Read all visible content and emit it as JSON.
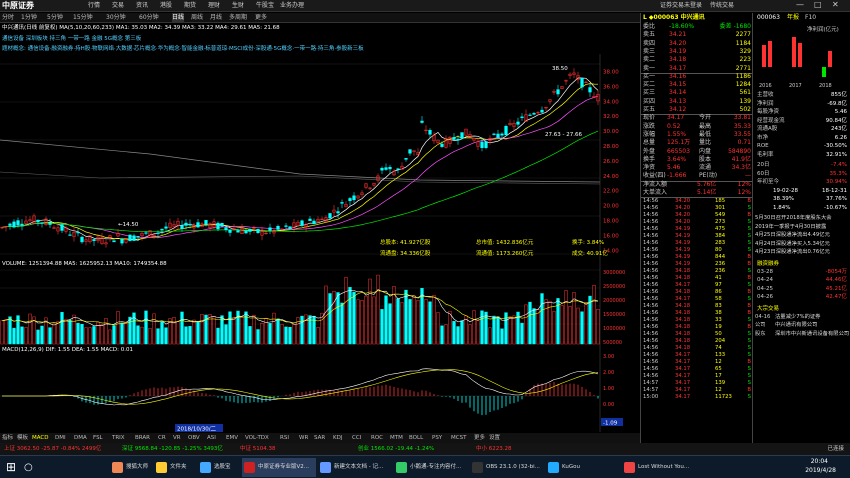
{
  "app": {
    "logo": "中原证券",
    "menu": [
      "系统",
      "功能",
      "报价",
      "分析",
      "资讯",
      "港股",
      "期权",
      "融资",
      "智能",
      "帮助"
    ],
    "menu2": [
      "行情",
      "交易",
      "资讯",
      "港股",
      "期货",
      "理财",
      "生财",
      "牛股宝",
      "业务办理"
    ],
    "title_right": "证券交易未登录",
    "title_right2": "传统交易"
  },
  "periods": [
    "分时",
    "1分钟",
    "5分钟",
    "15分钟",
    "30分钟",
    "60分钟",
    "日线",
    "周线",
    "月线",
    "多周期",
    "更多"
  ],
  "info_line": "中兴通讯(日线 前复权)  MA(5,10,20,60,233) MA1: 35.03  MA2: 34.39  MA3: 33.22  MA4: 29.61  MA5: 21.68",
  "tags_line": "通信设备   深圳板块   持三角 一带一路   金融 5G概念   第三板",
  "tags_line2": "题材概念:  通信设备·融资融券·持H股·物联网络·大数据·芯片概念·华为概念·智能金融·标普道琼·MSCI成份·深股通·5G概念·一带一路·持三角·参股新三板",
  "chart": {
    "high_label": "38.50",
    "low_label": "14.50",
    "range_label": "27.63 - 27.66",
    "annotations": {
      "a1": "总股本: 41.927亿股",
      "a2": "流通盘: 34.336亿股",
      "a3": "总市值: 1432.836亿元",
      "a4": "流通值: 1173.260亿元",
      "a5": "换手: 3.84%",
      "a6": "成交: 40.91亿"
    },
    "price_axis": [
      "38.00",
      "36.00",
      "34.00",
      "32.00",
      "30.00",
      "28.00",
      "26.00",
      "24.00",
      "22.00",
      "20.00",
      "18.00",
      "16.00",
      "14.00"
    ],
    "vol_label": "VOLUME: 1251394.88  MA5: 1625952.13  MA10: 1749354.88",
    "vol_axis": [
      "3000000",
      "2500000",
      "2000000",
      "1500000",
      "1000000",
      "500000"
    ],
    "macd_label": "MACD(12,26,9)  DIF: 1.55  DEA: 1.55  MACD: 0.01",
    "macd_axis": [
      "3.00",
      "2.00",
      "1.00",
      "0.00",
      "-1.00"
    ],
    "date_marker": "2018/10/30/二",
    "macd_val": "-1.09"
  },
  "indicator_tabs": [
    "指标",
    "模板",
    "MACD",
    "DMI",
    "DMA",
    "FSL",
    "TRIX",
    "BRAR",
    "CR",
    "VR",
    "OBV",
    "ASI",
    "EMV",
    "VOL-TDX",
    "RSI",
    "WR",
    "SAR",
    "KDJ",
    "CCI",
    "ROC",
    "MTM",
    "BOLL",
    "PSY",
    "MCST",
    "更多",
    "设置"
  ],
  "quote": {
    "code": "000063",
    "name": "中兴通讯",
    "ratio_label": "委比",
    "ratio_val": "-18.60%",
    "diff_label": "委差",
    "diff_val": "-1680",
    "sells": [
      {
        "label": "卖五",
        "price": "34.21",
        "vol": "2277"
      },
      {
        "label": "卖四",
        "price": "34.20",
        "vol": "1184"
      },
      {
        "label": "卖三",
        "price": "34.19",
        "vol": "329"
      },
      {
        "label": "卖二",
        "price": "34.18",
        "vol": "223"
      },
      {
        "label": "卖一",
        "price": "34.17",
        "vol": "2771"
      }
    ],
    "buys": [
      {
        "label": "买一",
        "price": "34.16",
        "vol": "1186"
      },
      {
        "label": "买二",
        "price": "34.15",
        "vol": "1284"
      },
      {
        "label": "买三",
        "price": "34.14",
        "vol": "561"
      },
      {
        "label": "买四",
        "price": "34.13",
        "vol": "139"
      },
      {
        "label": "买五",
        "price": "34.12",
        "vol": "502"
      }
    ],
    "stats": [
      {
        "l": "现价",
        "v": "34.17",
        "l2": "今开",
        "v2": "33.81"
      },
      {
        "l": "涨跌",
        "v": "0.52",
        "l2": "最高",
        "v2": "35.33"
      },
      {
        "l": "涨幅",
        "v": "1.55%",
        "l2": "最低",
        "v2": "33.55"
      },
      {
        "l": "总量",
        "v": "125.1万",
        "l2": "量比",
        "v2": "0.71"
      },
      {
        "l": "外盘",
        "v": "665503",
        "l2": "内盘",
        "v2": "584890"
      },
      {
        "l": "换手",
        "v": "3.64%",
        "l2": "股本",
        "v2": "41.9亿"
      },
      {
        "l": "净资",
        "v": "5.46",
        "l2": "流通",
        "v2": "34.3亿"
      },
      {
        "l": "收益(四)",
        "v": "-1.666",
        "l2": "PE(动)",
        "v2": "—"
      }
    ],
    "flow": [
      {
        "l": "净流入额",
        "v": "5.76亿",
        "p": "12%"
      },
      {
        "l": "大单流入",
        "v": "5.14亿",
        "p": "12%"
      }
    ],
    "ticks": [
      [
        "14:56",
        "34.20",
        "185",
        "B"
      ],
      [
        "14:56",
        "34.20",
        "301",
        "S"
      ],
      [
        "14:56",
        "34.20",
        "549",
        "B"
      ],
      [
        "14:56",
        "34.20",
        "273",
        "S"
      ],
      [
        "14:56",
        "34.19",
        "475",
        "S"
      ],
      [
        "14:56",
        "34.19",
        "384",
        "S"
      ],
      [
        "14:56",
        "34.19",
        "283",
        "S"
      ],
      [
        "14:56",
        "34.19",
        "80",
        "S"
      ],
      [
        "14:56",
        "34.19",
        "844",
        "B"
      ],
      [
        "14:56",
        "34.19",
        "236",
        "B"
      ],
      [
        "14:56",
        "34.18",
        "236",
        "S"
      ],
      [
        "14:56",
        "34.18",
        "41",
        "B"
      ],
      [
        "14:56",
        "34.17",
        "97",
        "S"
      ],
      [
        "14:56",
        "34.18",
        "86",
        "B"
      ],
      [
        "14:56",
        "34.17",
        "58",
        "S"
      ],
      [
        "14:56",
        "34.18",
        "83",
        "B"
      ],
      [
        "14:56",
        "34.18",
        "38",
        "B"
      ],
      [
        "14:56",
        "34.18",
        "33",
        "S"
      ],
      [
        "14:56",
        "34.18",
        "19",
        "B"
      ],
      [
        "14:56",
        "34.18",
        "50",
        "S"
      ],
      [
        "14:56",
        "34.18",
        "204",
        "S"
      ],
      [
        "14:56",
        "34.18",
        "74",
        "S"
      ],
      [
        "14:56",
        "34.17",
        "133",
        "S"
      ],
      [
        "14:56",
        "34.17",
        "12",
        "B"
      ],
      [
        "14:56",
        "34.17",
        "65",
        "S"
      ],
      [
        "14:56",
        "34.17",
        "17",
        "S"
      ],
      [
        "14:57",
        "34.17",
        "139",
        "S"
      ],
      [
        "14:57",
        "34.17",
        "12",
        "B"
      ],
      [
        "15:00",
        "34.17",
        "11723",
        "S"
      ]
    ]
  },
  "fund": {
    "code": "000063",
    "tabs": [
      "年报",
      "F10"
    ],
    "chart_title": "净利润(亿元)",
    "years": [
      "2016",
      "2017",
      "2018"
    ],
    "rows": [
      {
        "l": "主营收",
        "v": "855亿"
      },
      {
        "l": "净利润",
        "v": "-69.8亿"
      },
      {
        "l": "每股净资",
        "v": "5.46"
      },
      {
        "l": "经营现金流",
        "v": "90.84亿"
      },
      {
        "l": "流通A股",
        "v": "243亿"
      },
      {
        "l": "市净",
        "v": "6.26"
      },
      {
        "l": "ROE",
        "v": "-30.50%"
      },
      {
        "l": "毛利率",
        "v": "32.91%"
      }
    ],
    "pe_title": "PE",
    "pe_v": "—",
    "pb": "6.26",
    "ratios": [
      {
        "l": "20日",
        "v": "-7.4%"
      },
      {
        "l": "60日",
        "v": "35.3%"
      },
      {
        "l": "年初至今",
        "v": "30.94%"
      }
    ],
    "hist": [
      {
        "d": "19-02-28",
        "v": "18-12-31"
      },
      {
        "d": "38.39%",
        "v": "37.76%"
      },
      {
        "d": "1.84%",
        "v": "-10.67%"
      }
    ],
    "news": [
      "5月30日召开2018年度股东大会",
      "2019年一季报于4月30日披露",
      "4月25日深股通净流出4.49亿元",
      "4月24日深股通净买入5.34亿元",
      "4月23日深股通净流出0.76亿元"
    ],
    "margin_title": "融资融券",
    "margin_rows": [
      {
        "d": "03-28",
        "v": "-8054万"
      },
      {
        "d": "04-24",
        "v": "44.46亿"
      },
      {
        "d": "04-25",
        "v": "45.21亿"
      },
      {
        "d": "04-26",
        "v": "42.47亿"
      }
    ],
    "big_title": "大宗交易",
    "big_rows": [
      {
        "d": "04-16",
        "v": "沽量减少7%的证券"
      },
      {
        "d": "公司",
        "v": "中兴通讯有限公司"
      },
      {
        "d": "股东",
        "v": "深圳市中兴新通讯设备有限公司"
      }
    ]
  },
  "statusbar": {
    "items": [
      "上证 3062.50 -25.87 -0.84% 2499亿",
      "深证 9568.84 -120.85 -1.25% 3493亿",
      "中证 5104.38",
      "创业 1566.02 -19.44 -1.24%",
      "中小 6223.28"
    ],
    "right": "已连接"
  },
  "taskbar": {
    "apps": [
      "搜狐大师",
      "文件夹",
      "选股宝",
      "中原证券专业版V2...",
      "新建文本文档 - 记...",
      "小鹅通-专注内容付...",
      "OBS 23.1.0 (32-bi...",
      "KuGou",
      "Lost Without You..."
    ],
    "time": "20:04",
    "date": "2019/4/28"
  },
  "colors": {
    "up": "#ff3232",
    "down": "#00ffff",
    "ma5": "#ffffff",
    "ma10": "#ffff00",
    "ma20": "#ff4fff",
    "ma60": "#00e600",
    "ma233": "#888888"
  }
}
